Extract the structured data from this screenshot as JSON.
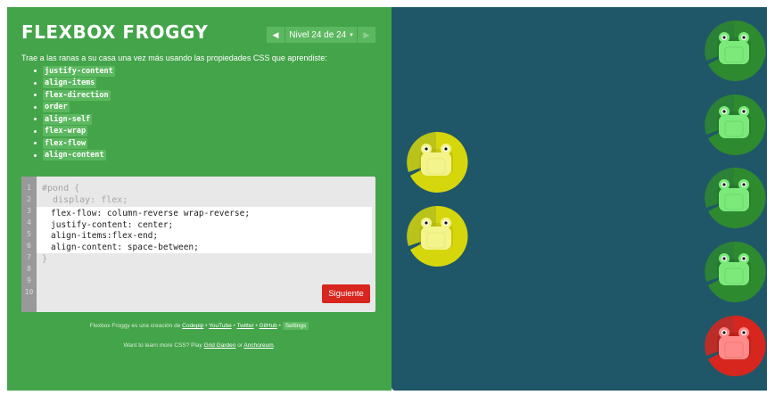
{
  "game": {
    "logo": "FLEXBOX FROGGY",
    "level_label": "Nivel 24 de 24",
    "prev_arrow": "◀",
    "next_arrow": "▶",
    "level_caret": "▾",
    "instructions": "Trae a las ranas a su casa una vez más usando las propiedades CSS que aprendiste:",
    "properties": [
      "justify-content",
      "align-items",
      "flex-direction",
      "order",
      "align-self",
      "flex-wrap",
      "flex-flow",
      "align-content"
    ]
  },
  "editor": {
    "line_numbers": [
      "1",
      "2",
      "3",
      "4",
      "5",
      "6",
      "7",
      "8",
      "9",
      "10"
    ],
    "selector_line": "#pond {",
    "display_line": "  display: flex;",
    "user_lines": [
      "flex-flow: column-reverse wrap-reverse;",
      "justify-content: center;",
      "align-items:flex-end;",
      "align-content: space-between;"
    ],
    "closing_line": "}",
    "next_button": "Siguiente"
  },
  "footer": {
    "credit_prefix": "Flexbox Froggy es una creación de",
    "codepip": "Codepip",
    "sep": "•",
    "youtube": "YouTube",
    "twitter": "Twitter",
    "github": "GitHub",
    "settings": "Settings",
    "more_prefix": "Want to learn more CSS? Play",
    "grid_garden": "Grid Garden",
    "or": "or",
    "anchoreum": "Anchoreum",
    "period": "."
  },
  "colors": {
    "sidebar_bg": "#44a44a",
    "pond_bg": "#1f5768",
    "green_lily": "#2e8a2f",
    "green_frog": "#7bea7b",
    "yellow_lily": "#d6d60c",
    "yellow_frog": "#f4f48c",
    "red_lily": "#d7261e",
    "red_frog": "#ff8a8a",
    "button": "#d7261e"
  },
  "pond": {
    "lilypads": [
      {
        "color": "green"
      },
      {
        "color": "green"
      },
      {
        "color": "green"
      },
      {
        "color": "green"
      },
      {
        "color": "red"
      },
      {
        "color": "yellow"
      },
      {
        "color": "yellow"
      }
    ]
  }
}
